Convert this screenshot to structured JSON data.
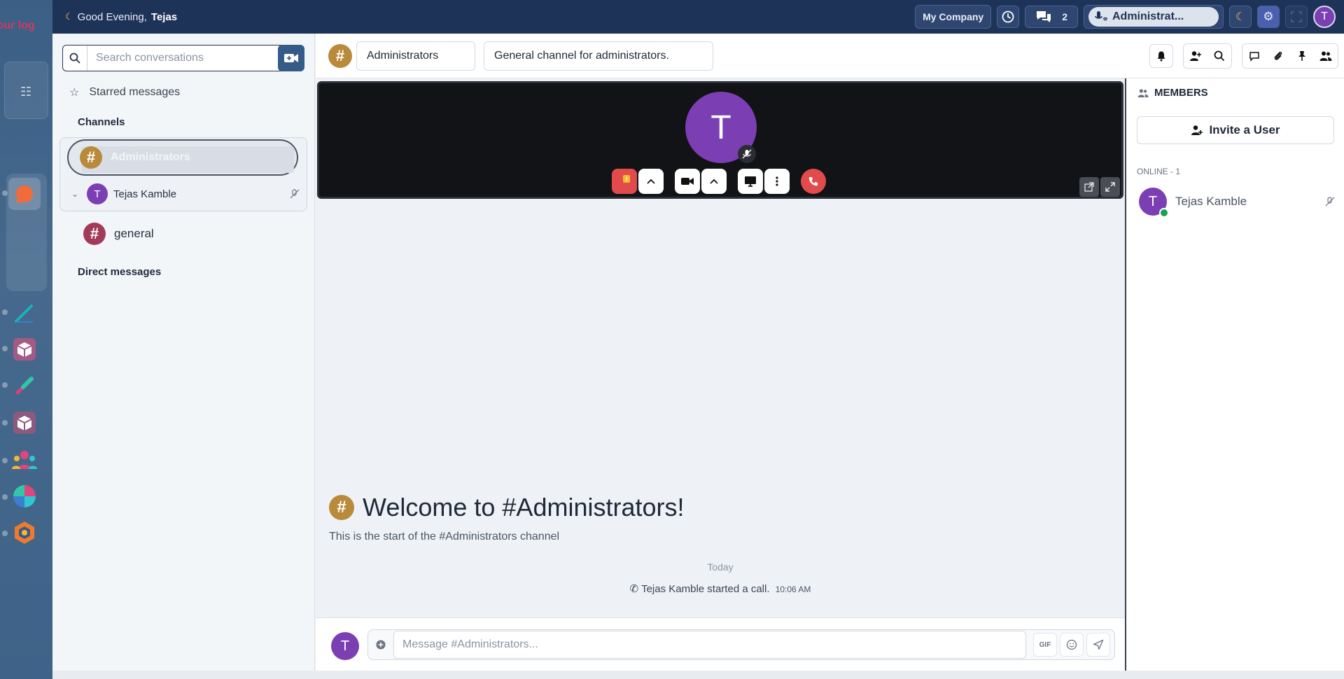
{
  "rail": {
    "logo_text": "Your log"
  },
  "topbar": {
    "greeting_prefix": "Good Evening,",
    "greeting_name": "Tejas",
    "company": "My Company",
    "chat_count": "2",
    "call_label": "Administrat...",
    "avatar_initial": "T"
  },
  "sidebar": {
    "search_placeholder": "Search conversations",
    "starred_label": "Starred messages",
    "channels_title": "Channels",
    "active_channel": "Administrators",
    "call_member": {
      "initial": "T",
      "name": "Tejas Kamble"
    },
    "other_channel": "general",
    "dm_title": "Direct messages"
  },
  "header": {
    "channel_name": "Administrators",
    "channel_topic": "General channel for administrators."
  },
  "video": {
    "avatar_initial": "T"
  },
  "chat": {
    "welcome_title": "Welcome to #Administrators!",
    "welcome_sub": "This is the start of the #Administrators channel",
    "date_divider": "Today",
    "system_message": "Tejas Kamble started a call.",
    "system_time": "10:06 AM"
  },
  "composer": {
    "avatar_initial": "T",
    "placeholder": "Message #Administrators...",
    "gif_label": "GIF"
  },
  "members": {
    "title": "MEMBERS",
    "invite_label": "Invite a User",
    "online_label": "ONLINE - 1",
    "list": [
      {
        "initial": "T",
        "name": "Tejas Kamble"
      }
    ]
  },
  "colors": {
    "topbar": "#1e3358",
    "channel_gold": "#b88a3a",
    "channel_maroon": "#a33a5a",
    "avatar_purple": "#7b3fb3",
    "call_red": "#e24b4b",
    "online_green": "#16a34a"
  }
}
